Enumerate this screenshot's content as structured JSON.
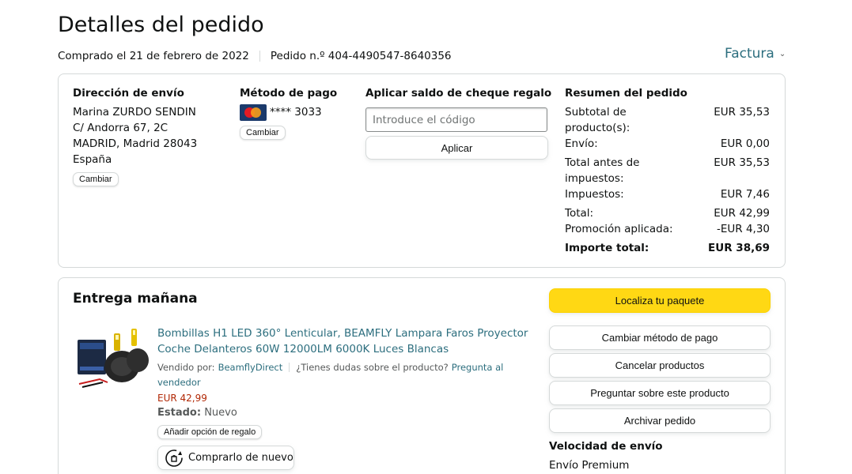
{
  "page": {
    "title": "Detalles del pedido",
    "purchased": "Comprado el 21 de febrero de 2022",
    "order_number": "Pedido n.º 404-4490547-8640356",
    "invoice": "Factura"
  },
  "shipping": {
    "title": "Dirección de envío",
    "name": "Marina ZURDO SENDIN",
    "street": "C/ Andorra 67, 2C",
    "city": "MADRID, Madrid 28043",
    "country": "España",
    "change": "Cambiar"
  },
  "payment": {
    "title": "Método de pago",
    "card": "**** 3033",
    "change": "Cambiar",
    "card_icon": "mastercard-icon"
  },
  "gift": {
    "title": "Aplicar saldo de cheque regalo",
    "placeholder": "Introduce el código",
    "apply": "Aplicar"
  },
  "summary": {
    "title": "Resumen del pedido",
    "rows": [
      {
        "label": "Subtotal de producto(s):",
        "value": "EUR 35,53"
      },
      {
        "label": "Envío:",
        "value": "EUR 0,00"
      },
      {
        "label": "Total antes de impuestos:",
        "value": "EUR 35,53"
      },
      {
        "label": "Impuestos:",
        "value": "EUR 7,46"
      },
      {
        "label": "Total:",
        "value": "EUR 42,99"
      },
      {
        "label": "Promoción aplicada:",
        "value": "-EUR 4,30"
      }
    ],
    "grand_label": "Importe total:",
    "grand_value": "EUR 38,69"
  },
  "delivery": {
    "title": "Entrega mañana",
    "product_title_1": "Bombillas H1 LED 360° Lenticular, BEAMFLY Lampara Faros Proyector",
    "product_title_2": "Coche Delanteros 60W 12000LM 6000K Luces Blancas",
    "sold_by": "Vendido por:",
    "seller": "BeamflyDirect",
    "question": "¿Tienes dudas sobre el producto?",
    "ask_seller_1": "Pregunta al",
    "ask_seller_2": "vendedor",
    "price": "EUR 42,99",
    "status_label": "Estado:",
    "status_value": "Nuevo",
    "gift_option": "Añadir opción de regalo",
    "buy_again": "Comprarlo de nuevo",
    "buy_again_icon": "reorder-icon"
  },
  "actions": {
    "track": "Localiza tu paquete",
    "change_payment": "Cambiar método de pago",
    "cancel": "Cancelar productos",
    "ask_product": "Preguntar sobre este producto",
    "archive": "Archivar pedido",
    "speed_title": "Velocidad de envío",
    "speed_value": "Envío Premium"
  },
  "colors": {
    "link": "#2c6e7e",
    "price": "#b12704",
    "primary_button": "#ffd814",
    "border": "#d5d9d9"
  }
}
